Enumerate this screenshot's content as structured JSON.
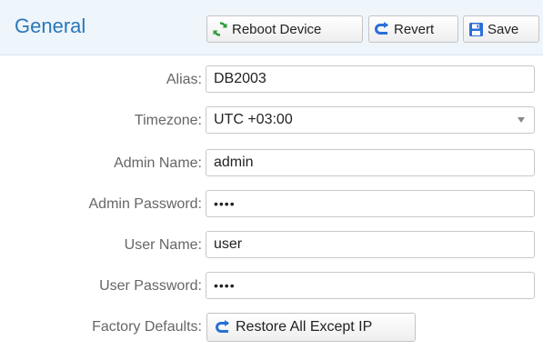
{
  "header": {
    "title": "General",
    "buttons": {
      "reboot": "Reboot Device",
      "revert": "Revert",
      "save": "Save"
    }
  },
  "form": {
    "alias": {
      "label": "Alias:",
      "value": "DB2003"
    },
    "timezone": {
      "label": "Timezone:",
      "value": "UTC +03:00"
    },
    "admin_name": {
      "label": "Admin Name:",
      "value": "admin"
    },
    "admin_password": {
      "label": "Admin Password:",
      "value": "••••"
    },
    "user_name": {
      "label": "User Name:",
      "value": "user"
    },
    "user_password": {
      "label": "User Password:",
      "value": "••••"
    },
    "factory_defaults": {
      "label": "Factory Defaults:",
      "button": "Restore All Except IP"
    }
  },
  "colors": {
    "title": "#2b77b8",
    "header_bg": "#eef5fb",
    "reboot_icon": "#2e9e3a",
    "revert_icon": "#2b6fd6",
    "save_icon": "#2b6fd6"
  },
  "icons": {
    "reboot": "refresh-icon",
    "revert": "revert-icon",
    "save": "floppy-disk-icon",
    "restore": "revert-icon"
  }
}
